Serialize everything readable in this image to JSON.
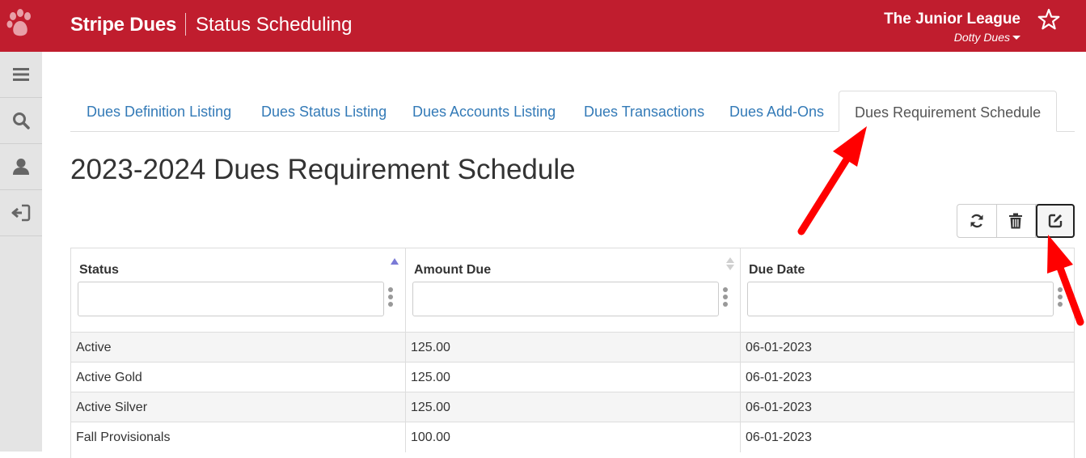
{
  "header": {
    "brand": "Stripe Dues",
    "subtitle": "Status Scheduling",
    "organization": "The Junior League",
    "user": "Dotty Dues",
    "colors": {
      "brand_red": "#c01d2e"
    }
  },
  "sidebar": {
    "items": [
      {
        "icon": "menu-icon"
      },
      {
        "icon": "search-icon"
      },
      {
        "icon": "user-icon"
      },
      {
        "icon": "sign-out-icon"
      }
    ]
  },
  "tabs": [
    {
      "label": "Dues Definition Listing",
      "active": false
    },
    {
      "label": "Dues Status Listing",
      "active": false
    },
    {
      "label": "Dues Accounts Listing",
      "active": false
    },
    {
      "label": "Dues Transactions",
      "active": false
    },
    {
      "label": "Dues Add-Ons",
      "active": false
    },
    {
      "label": "Dues Requirement Schedule",
      "active": true
    }
  ],
  "page": {
    "title": "2023-2024 Dues Requirement Schedule"
  },
  "toolbar": {
    "buttons": [
      "refresh-icon",
      "trash-icon",
      "edit-icon"
    ]
  },
  "table": {
    "columns": [
      {
        "label": "Status",
        "filter_value": "",
        "sort": "ascending"
      },
      {
        "label": "Amount Due",
        "filter_value": "",
        "sort": "none"
      },
      {
        "label": "Due Date",
        "filter_value": "",
        "sort": "none"
      }
    ],
    "rows": [
      [
        "Active",
        "125.00",
        "06-01-2023"
      ],
      [
        "Active Gold",
        "125.00",
        "06-01-2023"
      ],
      [
        "Active Silver",
        "125.00",
        "06-01-2023"
      ],
      [
        "Fall Provisionals",
        "100.00",
        "06-01-2023"
      ]
    ]
  },
  "annotations": {
    "arrow_color": "#ff0000"
  }
}
